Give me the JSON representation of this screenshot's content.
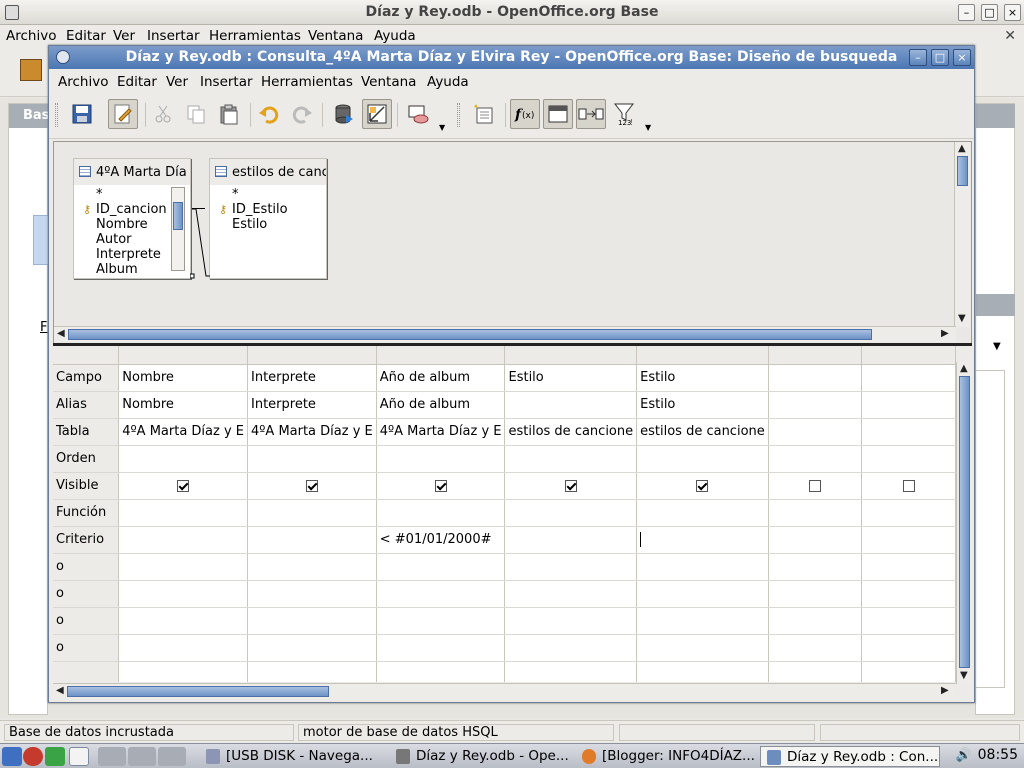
{
  "outer": {
    "title": "Díaz y Rey.odb - OpenOffice.org Base",
    "menu": [
      "Archivo",
      "Editar",
      "Ver",
      "Insertar",
      "Herramientas",
      "Ventana",
      "Ayuda"
    ],
    "close_mark": "✕",
    "panel_header": "Bas",
    "panel_mark": "F"
  },
  "inner": {
    "title": "Díaz y Rey.odb : Consulta_4ºA Marta Díaz y Elvira Rey - OpenOffice.org Base: Diseño de busqueda",
    "menu": [
      "Archivo",
      "Editar",
      "Ver",
      "Insertar",
      "Herramientas",
      "Ventana",
      "Ayuda"
    ],
    "toolbar": [
      "save",
      "edit-mode",
      "cut",
      "copy",
      "paste",
      "undo",
      "redo",
      "run-query",
      "design-view",
      "add-tables",
      "insert",
      "functions",
      "table-name",
      "alias",
      "distinct-values"
    ]
  },
  "tables": [
    {
      "name": "4ºA Marta Día",
      "fields": [
        {
          "label": "*",
          "key": false
        },
        {
          "label": "ID_cancion",
          "key": true
        },
        {
          "label": "Nombre",
          "key": false
        },
        {
          "label": "Autor",
          "key": false
        },
        {
          "label": "Interprete",
          "key": false
        },
        {
          "label": "Album",
          "key": false
        }
      ]
    },
    {
      "name": "estilos de canc",
      "fields": [
        {
          "label": "*",
          "key": false
        },
        {
          "label": "ID_Estilo",
          "key": true
        },
        {
          "label": "Estilo",
          "key": false
        }
      ]
    }
  ],
  "grid": {
    "row_labels": [
      "Campo",
      "Alias",
      "Tabla",
      "Orden",
      "Visible",
      "Función",
      "Criterio",
      "o",
      "o",
      "o",
      "o"
    ],
    "columns": [
      {
        "campo": "Nombre",
        "alias": "Nombre",
        "tabla": "4ºA Marta Díaz y E",
        "orden": "",
        "visible": true,
        "funcion": "",
        "criterio": ""
      },
      {
        "campo": "Interprete",
        "alias": "Interprete",
        "tabla": "4ºA Marta Díaz y E",
        "orden": "",
        "visible": true,
        "funcion": "",
        "criterio": ""
      },
      {
        "campo": "Año de album",
        "alias": "Año de album",
        "tabla": "4ºA Marta Díaz y E",
        "orden": "",
        "visible": true,
        "funcion": "",
        "criterio": "< #01/01/2000#"
      },
      {
        "campo": "Estilo",
        "alias": "",
        "tabla": "estilos de cancione",
        "orden": "",
        "visible": true,
        "funcion": "",
        "criterio": ""
      },
      {
        "campo": "Estilo",
        "alias": "Estilo",
        "tabla": "estilos de cancione",
        "orden": "",
        "visible": true,
        "funcion": "",
        "criterio": ""
      },
      {
        "campo": "",
        "alias": "",
        "tabla": "",
        "orden": "",
        "visible": false,
        "funcion": "",
        "criterio": ""
      },
      {
        "campo": "",
        "alias": "",
        "tabla": "",
        "orden": "",
        "visible": false,
        "funcion": "",
        "criterio": ""
      }
    ]
  },
  "statusbar": [
    "Base de datos incrustada",
    "motor de base de datos HSQL",
    "",
    ""
  ],
  "taskbar": {
    "tasks": [
      {
        "label": "[USB DISK - Navega...",
        "active": false
      },
      {
        "label": "Díaz y Rey.odb - Ope...",
        "active": false
      },
      {
        "label": "[Blogger: INFO4DÍAZ...",
        "active": false
      },
      {
        "label": "Díaz y Rey.odb : Con...",
        "active": true
      }
    ],
    "clock": "08:55"
  },
  "colors": {
    "title_active": "#4c77b3",
    "selection": "#6d93c7"
  }
}
